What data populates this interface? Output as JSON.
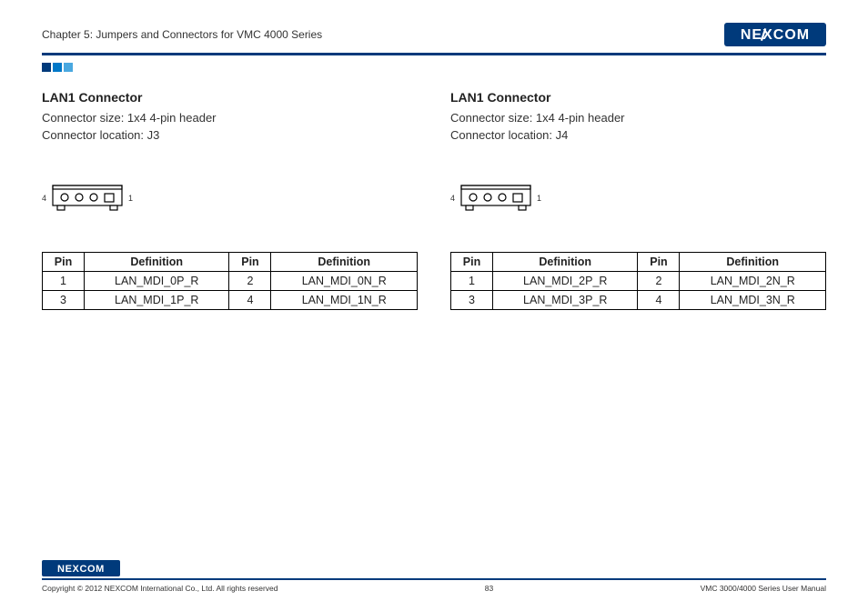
{
  "header": {
    "chapter_title": "Chapter 5: Jumpers and Connectors for VMC 4000 Series",
    "brand": "NEXCOM"
  },
  "squares_colors": [
    "#003a7b",
    "#0078c8",
    "#4aa8e0"
  ],
  "left": {
    "title": "LAN1 Connector",
    "size_line": "Connector size: 1x4 4-pin header",
    "loc_line": "Connector location: J3",
    "pin_label_left": "4",
    "pin_label_right": "1",
    "table": {
      "headers": [
        "Pin",
        "Definition",
        "Pin",
        "Definition"
      ],
      "rows": [
        [
          "1",
          "LAN_MDI_0P_R",
          "2",
          "LAN_MDI_0N_R"
        ],
        [
          "3",
          "LAN_MDI_1P_R",
          "4",
          "LAN_MDI_1N_R"
        ]
      ]
    }
  },
  "right": {
    "title": "LAN1 Connector",
    "size_line": "Connector size: 1x4 4-pin header",
    "loc_line": "Connector location: J4",
    "pin_label_left": "4",
    "pin_label_right": "1",
    "table": {
      "headers": [
        "Pin",
        "Definition",
        "Pin",
        "Definition"
      ],
      "rows": [
        [
          "1",
          "LAN_MDI_2P_R",
          "2",
          "LAN_MDI_2N_R"
        ],
        [
          "3",
          "LAN_MDI_3P_R",
          "4",
          "LAN_MDI_3N_R"
        ]
      ]
    }
  },
  "footer": {
    "copyright": "Copyright © 2012 NEXCOM International Co., Ltd. All rights reserved",
    "page_number": "83",
    "doc_title": "VMC 3000/4000 Series User Manual"
  }
}
